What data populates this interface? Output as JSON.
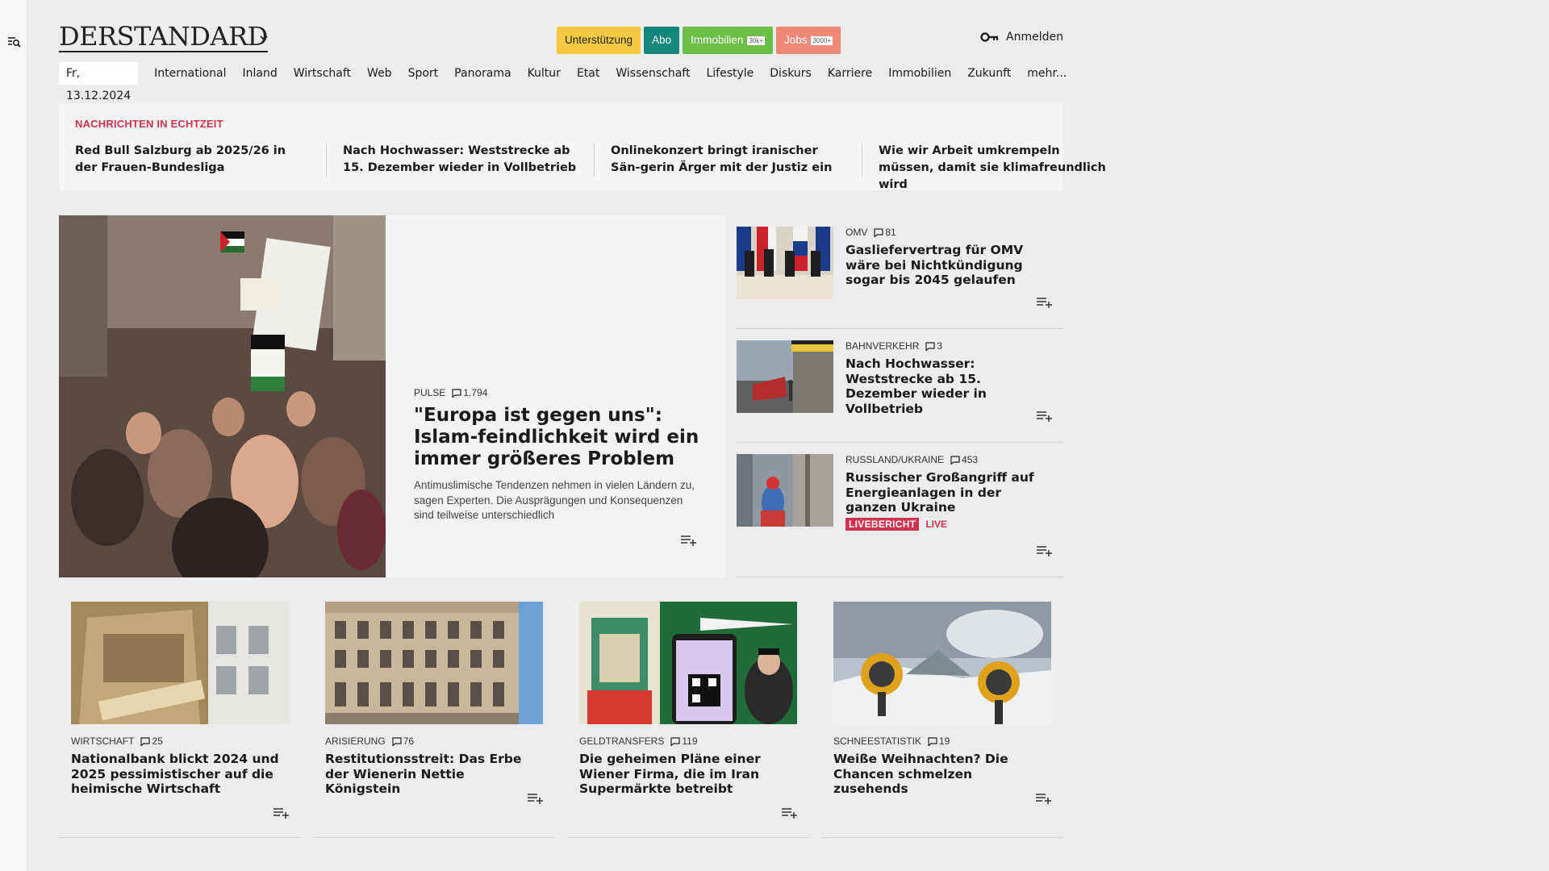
{
  "header": {
    "logo": "DERSTANDARD",
    "pills": {
      "support": "Unterstützung",
      "abo": "Abo",
      "immo": "Immobilien",
      "immo_tag": "30k+",
      "jobs": "Jobs",
      "jobs_tag": "3000+"
    },
    "login": "Anmelden"
  },
  "nav": {
    "date": "Fr, 13.12.2024",
    "items": [
      "International",
      "Inland",
      "Wirtschaft",
      "Web",
      "Sport",
      "Panorama",
      "Kultur",
      "Etat",
      "Wissenschaft",
      "Lifestyle",
      "Diskurs",
      "Karriere",
      "Immobilien",
      "Zukunft",
      "mehr..."
    ]
  },
  "ticker": {
    "title": "NACHRICHTEN IN ECHTZEIT",
    "items": [
      "Red Bull Salzburg ab 2025/26 in der Frauen-Bundesliga",
      "Nach Hochwasser: Weststrecke ab 15. Dezember wieder in Vollbetrieb",
      "Onlinekonzert bringt iranischer Sän-gerin Ärger mit der Justiz ein",
      "Wie wir Arbeit umkrempeln müssen, damit sie klimafreundlich wird"
    ]
  },
  "hero": {
    "kicker": "PULSE",
    "comments": "1.794",
    "title": "\"Europa ist gegen uns\": Islam-feindlichkeit wird ein immer größeres Problem",
    "lead": "Antimuslimische Tendenzen nehmen in vielen Ländern zu, sagen Experten. Die Ausprägungen und Konsequenzen sind teilweise unterschiedlich"
  },
  "side": [
    {
      "kicker": "OMV",
      "comments": "81",
      "title": "Gasliefervertrag für OMV wäre bei Nichtkündigung sogar bis 2045 gelaufen"
    },
    {
      "kicker": "BAHNVERKEHR",
      "comments": "3",
      "title": "Nach Hochwasser: Weststrecke ab 15. Dezember wieder in Vollbetrieb"
    },
    {
      "kicker": "RUSSLAND/UKRAINE",
      "comments": "453",
      "title": "Russischer Großangriff auf Energieanlagen in der ganzen Ukraine",
      "badge": "LIVEBERICHT",
      "live": "LIVE"
    }
  ],
  "cards": [
    {
      "kicker": "WIRTSCHAFT",
      "comments": "25",
      "title": "Nationalbank blickt 2024 und 2025 pessimistischer auf die heimische Wirtschaft"
    },
    {
      "kicker": "ARISIERUNG",
      "comments": "76",
      "title": "Restitutionsstreit: Das Erbe der Wienerin Nettie Königstein"
    },
    {
      "kicker": "GELDTRANSFERS",
      "comments": "119",
      "title": "Die geheimen Pläne einer Wiener Firma, die im Iran Supermärkte betreibt"
    },
    {
      "kicker": "SCHNEESTATISTIK",
      "comments": "19",
      "title": "Weiße Weihnachten? Die Chancen schmelzen zusehends"
    }
  ],
  "colors": {
    "accent_red": "#d2314f",
    "support": "#f6c945",
    "abo": "#14867a",
    "immo": "#6cbf45",
    "jobs": "#ef8876"
  }
}
